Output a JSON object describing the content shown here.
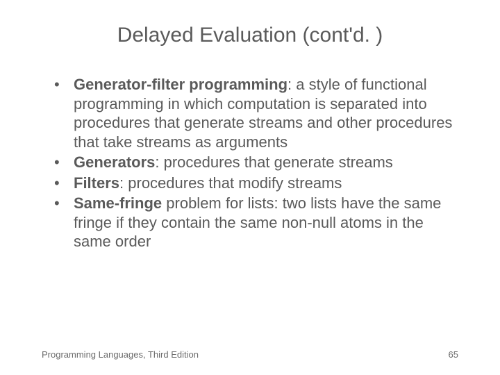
{
  "title": "Delayed Evaluation (cont'd. )",
  "bullets": [
    {
      "term": "Generator-filter programming",
      "rest": ": a style of functional programming in which computation is separated into procedures that generate streams and other procedures that take streams as arguments"
    },
    {
      "term": "Generators",
      "rest": ": procedures that generate streams"
    },
    {
      "term": "Filters",
      "rest": ": procedures that modify streams"
    },
    {
      "term": "Same-fringe",
      "rest": " problem for lists: two lists have the same fringe if they contain the same non-null atoms in the same order"
    }
  ],
  "footer_left": "Programming Languages, Third Edition",
  "footer_right": "65"
}
